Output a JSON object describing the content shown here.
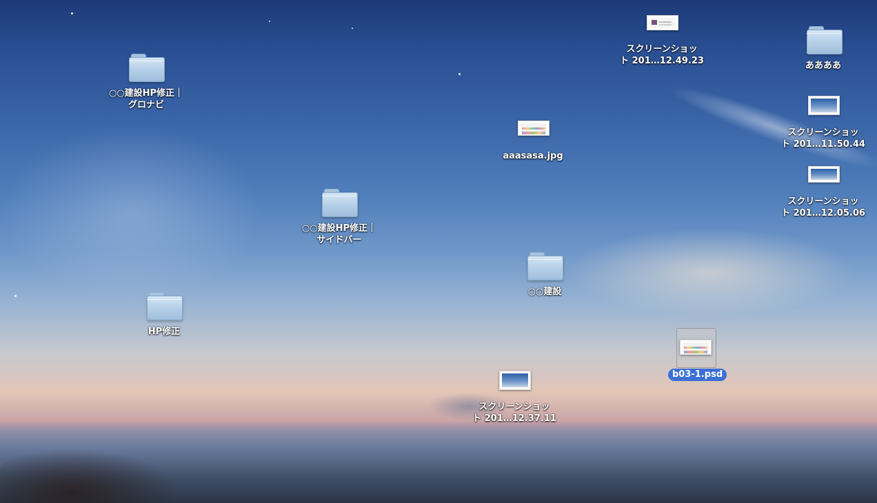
{
  "desktop": {
    "icons": [
      {
        "id": "f1",
        "kind": "folder",
        "line1": "○○建設HP修正｜",
        "line2": "グロナビ"
      },
      {
        "id": "f2",
        "kind": "folder",
        "line1": "○○建設HP修正｜",
        "line2": "サイドバー"
      },
      {
        "id": "f3",
        "kind": "folder",
        "line1": "HP修正",
        "line2": ""
      },
      {
        "id": "f4",
        "kind": "folder",
        "line1": "○○建設",
        "line2": ""
      },
      {
        "id": "f5",
        "kind": "folder",
        "line1": "ああああ",
        "line2": ""
      },
      {
        "id": "s1",
        "kind": "screenshot",
        "line1": "スクリーンショッ",
        "line2": "ト 201…12.49.23"
      },
      {
        "id": "s2",
        "kind": "screenshot",
        "line1": "スクリーンショッ",
        "line2": "ト 201…11.50.44"
      },
      {
        "id": "s3",
        "kind": "screenshot",
        "line1": "スクリーンショッ",
        "line2": "ト 201…12.05.06"
      },
      {
        "id": "s4",
        "kind": "screenshot",
        "line1": "スクリーンショッ",
        "line2": "ト 201…12.37.11"
      },
      {
        "id": "j1",
        "kind": "image",
        "line1": "aaasasa.jpg",
        "line2": ""
      },
      {
        "id": "p1",
        "kind": "psd",
        "line1": "b03-1.psd",
        "line2": "",
        "selected": true
      }
    ]
  }
}
